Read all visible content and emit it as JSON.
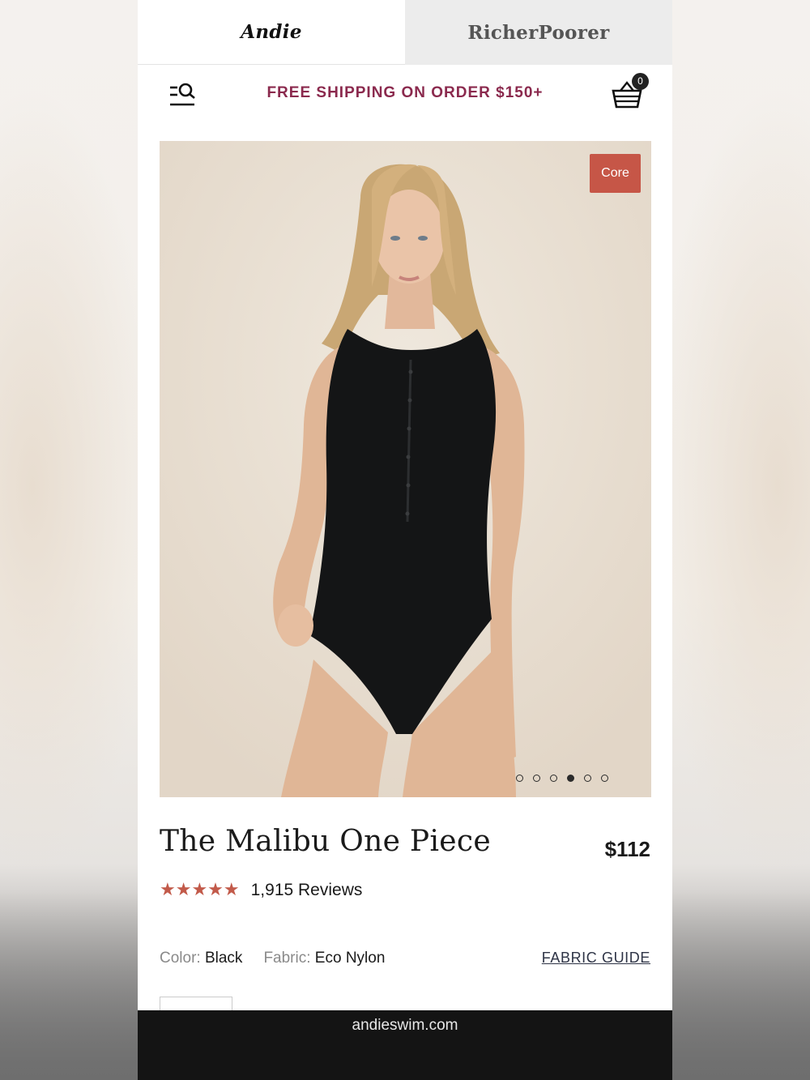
{
  "tabs": [
    {
      "label": "Andie",
      "active": true
    },
    {
      "label": "RicherPoorer",
      "active": false
    }
  ],
  "header": {
    "promo": "FREE SHIPPING ON ORDER $150+",
    "cart_count": "0",
    "menu_icon": "menu-search-icon",
    "cart_icon": "basket-icon"
  },
  "product": {
    "badge": "Core",
    "title": "The Malibu One Piece",
    "price": "$112",
    "stars": "★★★★★",
    "rating_value": 5,
    "reviews": "1,915 Reviews",
    "color_label": "Color:",
    "color_value": "Black",
    "fabric_label": "Fabric:",
    "fabric_value": "Eco Nylon",
    "fabric_guide": "FABRIC GUIDE",
    "carousel_total": 6,
    "carousel_active": 4
  },
  "browser": {
    "url": "andieswim.com"
  },
  "colors": {
    "promo": "#8b2a4e",
    "badge": "#c65647",
    "stars": "#c25a4a",
    "url_bar": "#141414"
  }
}
